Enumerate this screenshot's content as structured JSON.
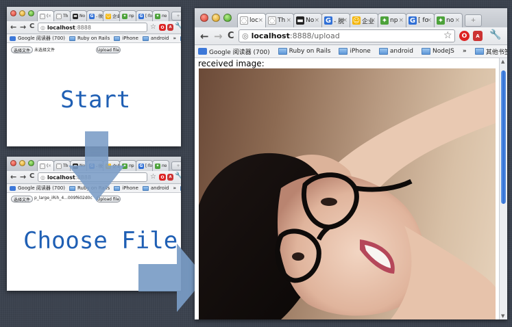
{
  "colors": {
    "background": "#3c434f",
    "annotation_text": "#1f5fb4",
    "arrow": "#7a9cc6"
  },
  "small_window_tabs": [
    {
      "icon": "loading-icon",
      "label": "("
    },
    {
      "icon": "loading-icon",
      "label": "Th"
    },
    {
      "icon": "node-logo-icon",
      "label": "No"
    },
    {
      "icon": "google-icon",
      "label": "- 脱"
    },
    {
      "icon": "qzone-icon",
      "label": "企业"
    },
    {
      "icon": "npm-icon",
      "label": "np"
    },
    {
      "icon": "google-icon",
      "label": "[ fo"
    },
    {
      "icon": "npm-icon",
      "label": "no"
    }
  ],
  "main_tabs": [
    {
      "icon": "loading-icon",
      "label": "loc"
    },
    {
      "icon": "loading-icon",
      "label": "Th"
    },
    {
      "icon": "node-logo-icon",
      "label": "No"
    },
    {
      "icon": "google-icon",
      "label": "- 脱"
    },
    {
      "icon": "qzone-icon",
      "label": "企业"
    },
    {
      "icon": "npm-icon",
      "label": "np"
    },
    {
      "icon": "google-icon",
      "label": "[ fo"
    },
    {
      "icon": "npm-icon",
      "label": "no"
    }
  ],
  "window1": {
    "url_host": "localhost",
    "url_path": ":8888",
    "choose_button": "选择文件",
    "no_file_text": "未选择文件",
    "upload_button": "Upload file"
  },
  "window2": {
    "url_host": "localhost",
    "url_path": ":8888",
    "choose_button": "选择文件",
    "file_name": "p_large_iRih_4...009f602d0c",
    "upload_button": "Upload file"
  },
  "main_window": {
    "url_host": "localhost",
    "url_path": ":8888/upload",
    "received_label": "received image:"
  },
  "bookmarks_small": [
    {
      "icon": "google-icon",
      "label": "Google 阅读器 (700)"
    },
    {
      "icon": "folder-icon",
      "label": "Ruby on Rails"
    },
    {
      "icon": "folder-icon",
      "label": "iPhone"
    },
    {
      "icon": "folder-icon",
      "label": "android"
    }
  ],
  "bookmarks_main": [
    {
      "icon": "google-icon",
      "label": "Google 阅读器 (700)"
    },
    {
      "icon": "folder-icon",
      "label": "Ruby on Rails"
    },
    {
      "icon": "folder-icon",
      "label": "iPhone"
    },
    {
      "icon": "folder-icon",
      "label": "android"
    },
    {
      "icon": "folder-icon",
      "label": "NodeJS"
    }
  ],
  "other_bookmarks": "其他书签",
  "overflow_chevron": "»",
  "annotations": {
    "start": "Start",
    "choose_file": "Choose File"
  },
  "scroll_position": 0.05
}
